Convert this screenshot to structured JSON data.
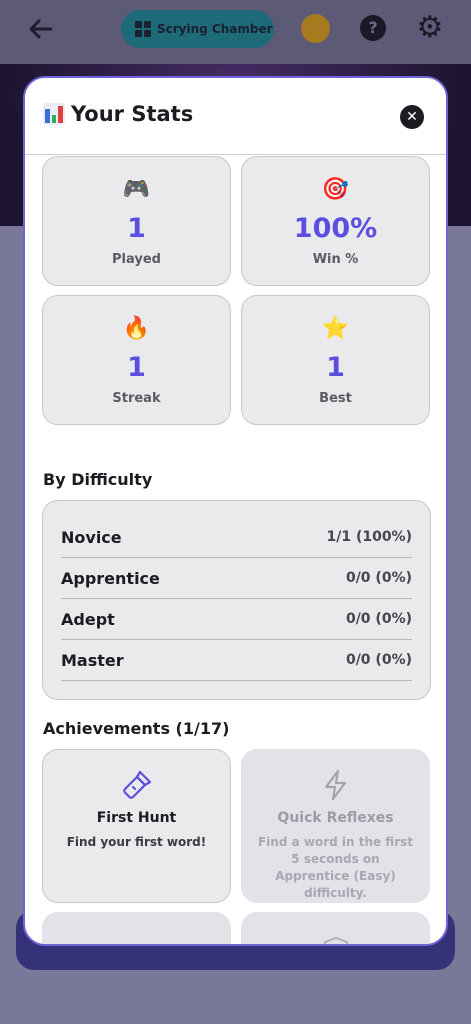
{
  "topbar": {
    "chamber_label": "Scrying Chamber",
    "icons": [
      "back-arrow-icon",
      "grid-icon",
      "pie-chart-icon",
      "help-icon",
      "gear-icon"
    ]
  },
  "modal": {
    "title": "Your Stats",
    "title_icon": "bar-chart-icon",
    "close_icon": "close-icon",
    "close_glyph": "✕"
  },
  "stats": [
    {
      "emoji": "🎮",
      "icon": "game-controller-icon",
      "value": "1",
      "label": "Played"
    },
    {
      "emoji": "🎯",
      "icon": "target-icon",
      "value": "100%",
      "label": "Win %"
    },
    {
      "emoji": "🔥",
      "icon": "fire-icon",
      "value": "1",
      "label": "Streak"
    },
    {
      "emoji": "⭐",
      "icon": "star-icon",
      "value": "1",
      "label": "Best"
    }
  ],
  "difficulty": {
    "title": "By Difficulty",
    "rows": [
      {
        "name": "Novice",
        "score": "1/1 (100%)"
      },
      {
        "name": "Apprentice",
        "score": "0/0 (0%)"
      },
      {
        "name": "Adept",
        "score": "0/0 (0%)"
      },
      {
        "name": "Master",
        "score": "0/0 (0%)"
      }
    ]
  },
  "achievements": {
    "title": "Achievements (1/17)",
    "items": [
      {
        "icon": "flashlight-icon",
        "title": "First Hunt",
        "desc": "Find your first word!",
        "unlocked": true
      },
      {
        "icon": "lightning-icon",
        "title": "Quick Reflexes",
        "desc": "Find a word in the first 5 seconds on Apprentice (Easy) difficulty.",
        "unlocked": false
      },
      {
        "icon": "sunrise-icon",
        "title": "",
        "desc": "",
        "unlocked": false
      },
      {
        "icon": "shield-icon",
        "title": "",
        "desc": "",
        "unlocked": false
      }
    ]
  },
  "colors": {
    "accent": "#5b4fe0",
    "modal_border": "#6f63d8",
    "chamber_button": "#1d6b78"
  }
}
